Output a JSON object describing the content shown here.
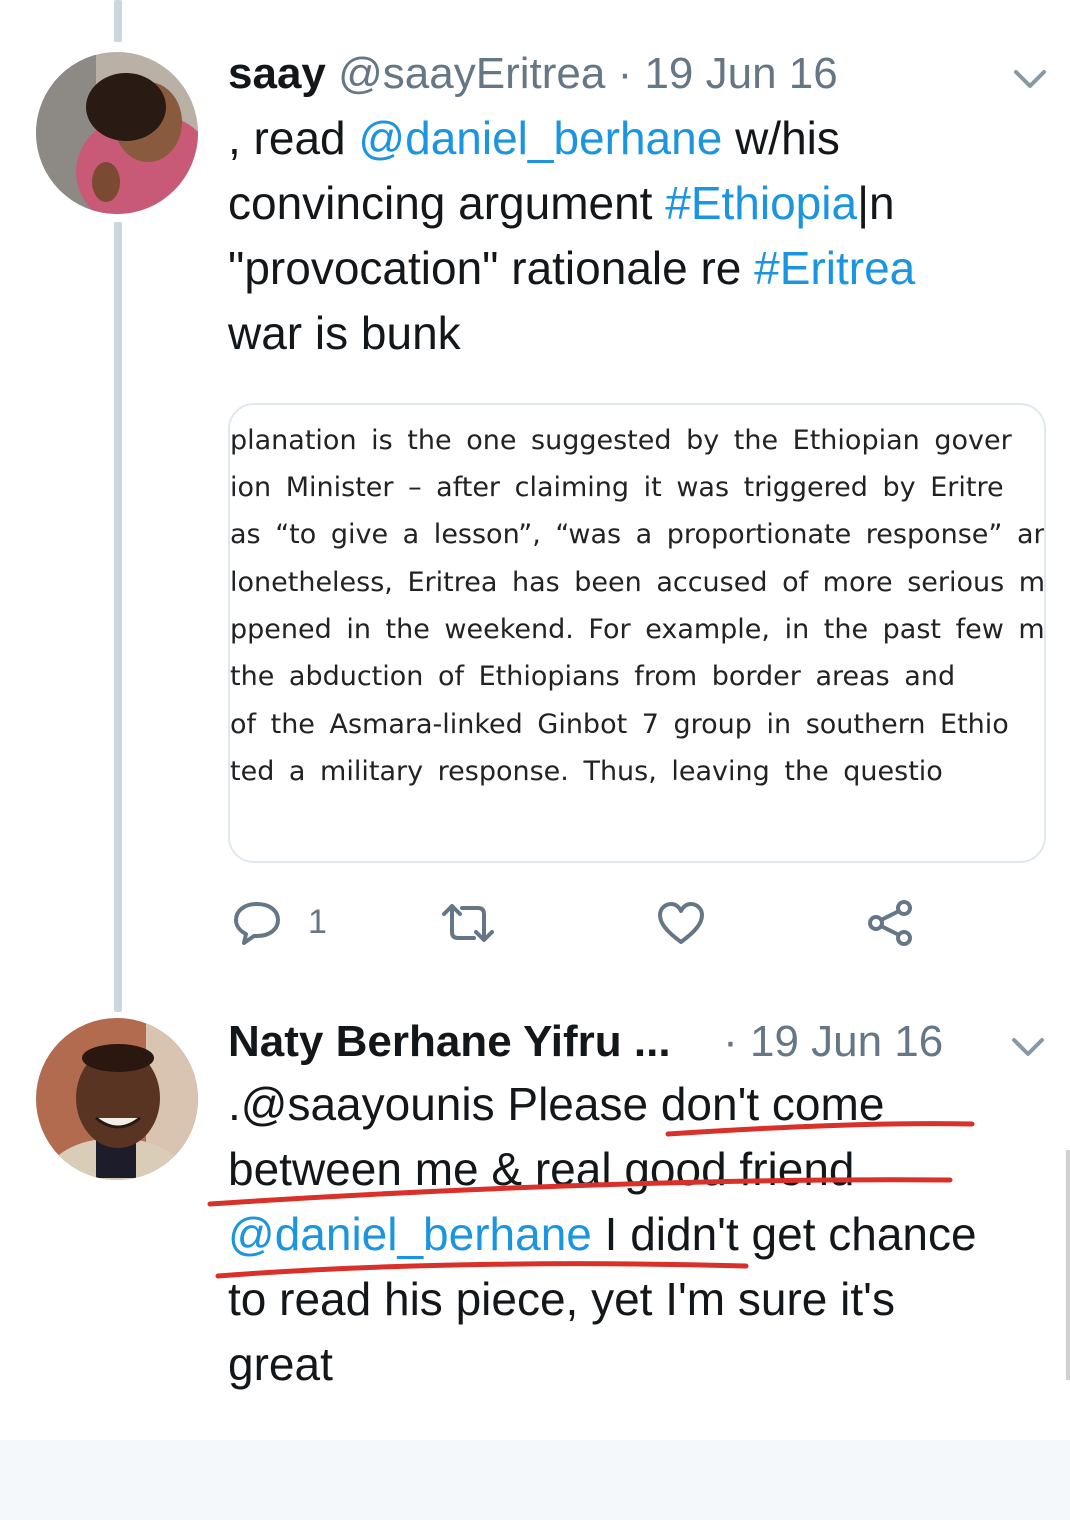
{
  "tweets": [
    {
      "name": "saay",
      "handle": "@saayEritrea",
      "separator": "·",
      "date": "19 Jun 16",
      "text_parts": [
        ", read ",
        "@daniel_berhane",
        " w/his",
        "convincing argument ",
        "#Ethiopia",
        "|n",
        "\"provocation\" rationale re ",
        "#Eritrea",
        "war is bunk"
      ],
      "reply_count": "1",
      "media_lines": [
        "planation is the one suggested by the Ethiopian gover",
        "ion Minister – after claiming it was triggered by Eritre",
        "as “to give a lesson”, “was a proportionate response” an",
        "lonetheless, Eritrea has been accused of more serious mi",
        "ppened in the weekend. For example, in the past few mc",
        "the abduction of Ethiopians from border areas and",
        "of the Asmara-linked Ginbot 7 group in southern Ethio",
        "ted a military response. Thus, leaving the questio"
      ]
    },
    {
      "name": "Naty Berhane Yifru",
      "ellipsis": "...",
      "separator": "·",
      "date": "19 Jun 16",
      "text_parts": [
        ".@saayounis Please don't come",
        "between me & real good friend",
        "@daniel_berhane",
        " I didn't get chance",
        "to read his piece, yet I'm sure it's",
        "great"
      ]
    }
  ],
  "icons": {
    "reply": "reply-icon",
    "retweet": "retweet-icon",
    "like": "heart-icon",
    "share": "share-icon",
    "caret": "chevron-down-icon"
  },
  "colors": {
    "link": "#1b95e0",
    "secondary": "#657786",
    "annotation": "#d9302a"
  }
}
